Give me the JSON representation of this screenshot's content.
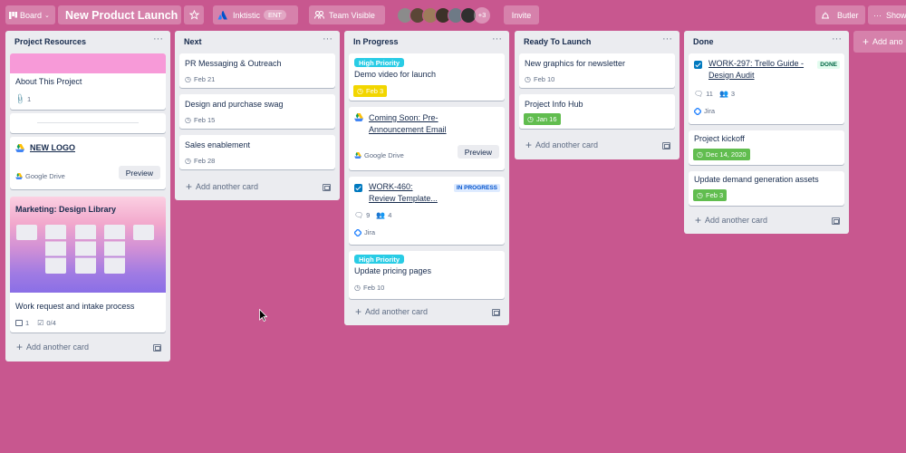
{
  "topbar": {
    "board_switch": "Board",
    "board_title": "New Product Launch",
    "workspace": "Inktistic",
    "workspace_badge": "ENT",
    "visibility": "Team Visible",
    "member_extra": "+3",
    "invite": "Invite",
    "butler": "Butler",
    "show_menu": "Show"
  },
  "lists": [
    {
      "title": "Project Resources",
      "cards": [
        {
          "title": "About This Project",
          "attachments": "1"
        },
        {
          "title": "NEW LOGO",
          "source": "Google Drive",
          "preview": "Preview"
        },
        {
          "cover_title": "Marketing: Design Library",
          "title": "Work request and intake process",
          "attachments": "1",
          "checklist": "0/4"
        }
      ],
      "add_card": "Add another card"
    },
    {
      "title": "Next",
      "cards": [
        {
          "title": "PR Messaging & Outreach",
          "date": "Feb 21"
        },
        {
          "title": "Design and purchase swag",
          "date": "Feb 15"
        },
        {
          "title": "Sales enablement",
          "date": "Feb 28"
        }
      ],
      "add_card": "Add another card"
    },
    {
      "title": "In Progress",
      "cards": [
        {
          "label": "High Priority",
          "title": "Demo video for launch",
          "date": "Feb 3"
        },
        {
          "title": "Coming Soon: Pre-Announcement Email",
          "source": "Google Drive",
          "preview": "Preview"
        },
        {
          "title": "WORK-460: Review Template...",
          "status": "IN PROGRESS",
          "comments": "9",
          "members": "4",
          "source": "Jira"
        },
        {
          "label": "High Priority",
          "title": "Update pricing pages",
          "date": "Feb 10"
        }
      ],
      "add_card": "Add another card"
    },
    {
      "title": "Ready To Launch",
      "cards": [
        {
          "title": "New graphics for newsletter",
          "date": "Feb 10"
        },
        {
          "title": "Project Info Hub",
          "date": "Jan 16"
        }
      ],
      "add_card": "Add another card"
    },
    {
      "title": "Done",
      "cards": [
        {
          "title": "WORK-297: Trello Guide - Design Audit",
          "status": "DONE",
          "comments": "11",
          "members": "3",
          "source": "Jira"
        },
        {
          "title": "Project kickoff",
          "date": "Dec 14, 2020"
        },
        {
          "title": "Update demand generation assets",
          "date": "Feb 3"
        }
      ],
      "add_card": "Add another card"
    }
  ],
  "add_list": "Add ano",
  "colors": {
    "background": "#c8578f",
    "list": "#ebecf0",
    "label_cyan": "#29cce5",
    "due_yellow": "#f2d600",
    "due_green": "#61bd4f",
    "cover_pink": "#f79ad8",
    "jira_blue": "#0052cc"
  }
}
